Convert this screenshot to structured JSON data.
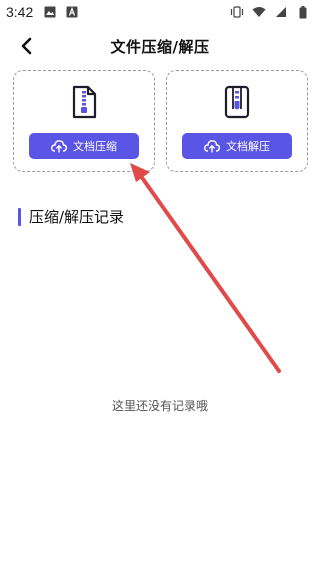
{
  "status_bar": {
    "time": "3:42",
    "left_icons": [
      "image-icon",
      "font-icon"
    ],
    "right_icons": [
      "vibrate-icon",
      "wifi-icon",
      "signal-icon",
      "battery-icon"
    ]
  },
  "header": {
    "title": "文件压缩/解压",
    "back_icon": "chevron-left-icon"
  },
  "cards": [
    {
      "icon": "zip-file-icon",
      "button_icon": "cloud-upload-icon",
      "button_label": "文档压缩"
    },
    {
      "icon": "unzip-file-icon",
      "button_icon": "cloud-upload-icon",
      "button_label": "文档解压"
    }
  ],
  "section": {
    "title": "压缩/解压记录"
  },
  "empty_state": {
    "text": "这里还没有记录哦"
  },
  "colors": {
    "accent": "#5b55e6",
    "annotation_arrow": "#e04a4a"
  }
}
